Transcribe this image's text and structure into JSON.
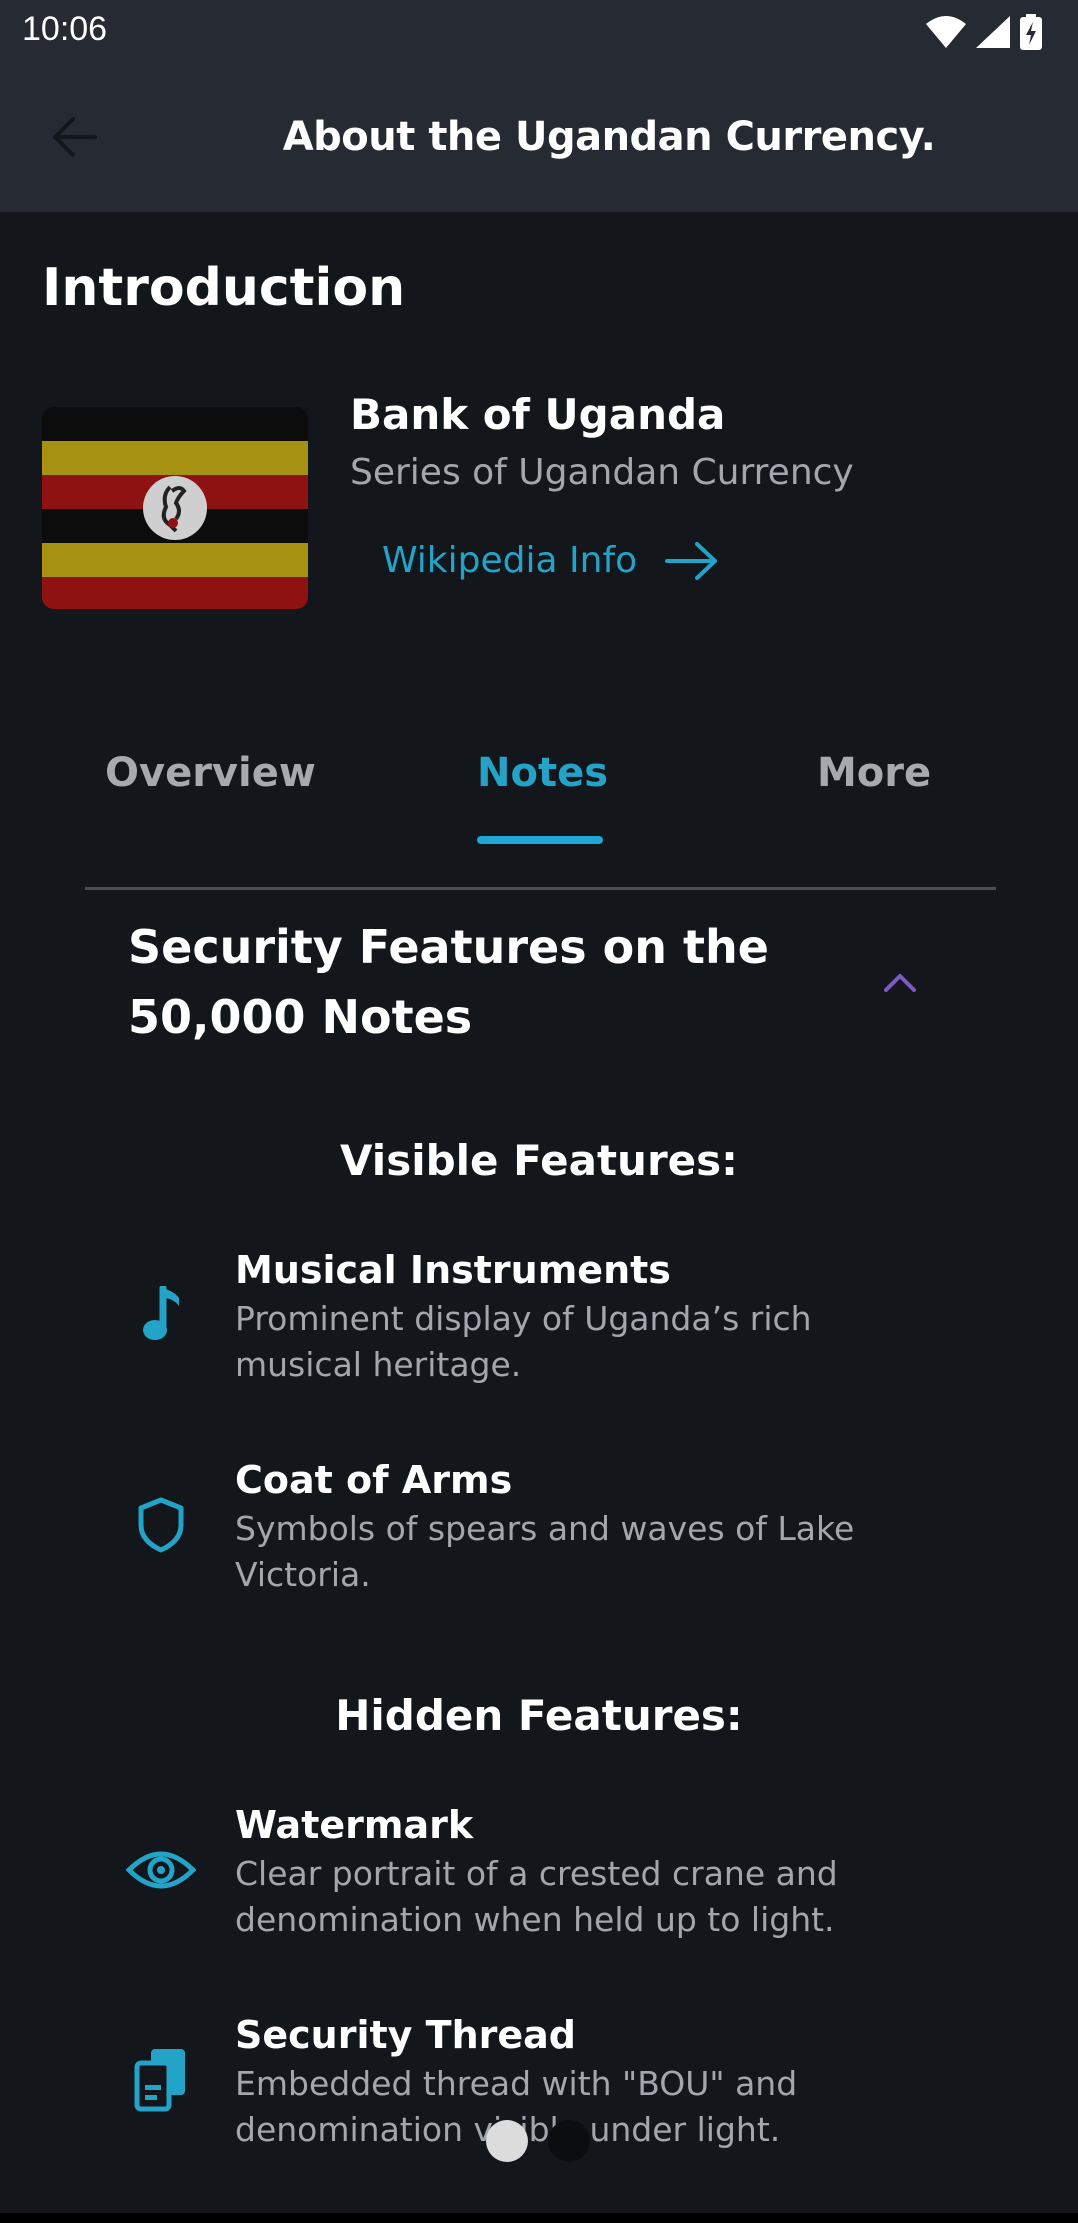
{
  "status_bar": {
    "time": "10:06"
  },
  "app_bar": {
    "title": "About the Ugandan Currency."
  },
  "intro": {
    "section_title": "Introduction",
    "bank_name": "Bank of Uganda",
    "subtitle": "Series of Ugandan Currency",
    "wiki_link": "Wikipedia Info"
  },
  "tabs": [
    {
      "label": "Overview",
      "active": false
    },
    {
      "label": "Notes",
      "active": true
    },
    {
      "label": "More",
      "active": false
    }
  ],
  "accordion": {
    "title": "Security Features on the 50,000 Notes",
    "expanded": true
  },
  "visible": {
    "heading": "Visible Features:",
    "items": [
      {
        "icon": "music-note-icon",
        "title": "Musical Instruments",
        "desc": "Prominent display of Uganda’s rich musical heritage."
      },
      {
        "icon": "shield-icon",
        "title": "Coat of Arms",
        "desc": "Symbols of spears and waves of Lake Victoria."
      }
    ]
  },
  "hidden": {
    "heading": "Hidden Features:",
    "items": [
      {
        "icon": "eye-icon",
        "title": "Watermark",
        "desc": "Clear portrait of a crested crane and denomination when held up to light."
      },
      {
        "icon": "thread-card-icon",
        "title": "Security Thread",
        "desc": "Embedded thread with \"BOU\" and denomination visible under light."
      }
    ]
  },
  "pager": {
    "pages": 2,
    "current": 1
  },
  "colors": {
    "accent": "#23a3c8",
    "background": "#13161b",
    "app_bar": "#262a32",
    "muted_text": "#a3a7ad",
    "toggle": "#7b5cc2"
  }
}
